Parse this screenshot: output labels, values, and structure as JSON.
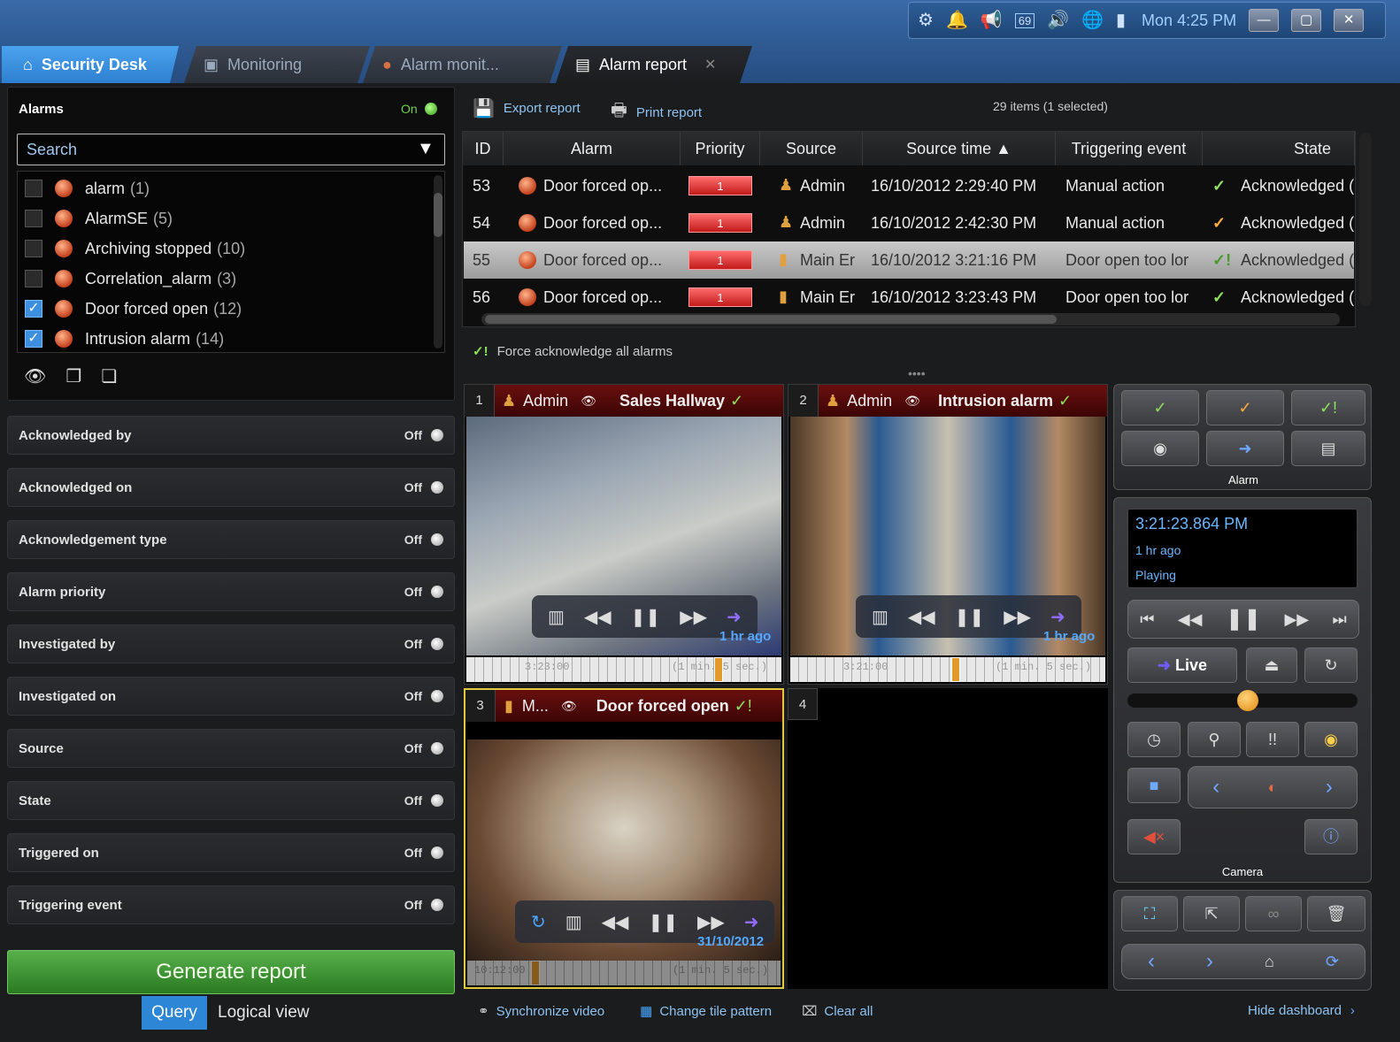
{
  "systray": {
    "clock": "Mon 4:25 PM",
    "badge": "69"
  },
  "tabs": [
    {
      "label": "Security Desk",
      "icon": "home-icon"
    },
    {
      "label": "Monitoring",
      "icon": "monitor-icon"
    },
    {
      "label": "Alarm monit...",
      "icon": "alarm-icon"
    },
    {
      "label": "Alarm report",
      "icon": "report-icon",
      "close": "✕"
    }
  ],
  "left": {
    "title": "Alarms",
    "on_label": "On",
    "search_placeholder": "Search",
    "alarms": [
      {
        "name": "alarm",
        "count": "(1)",
        "checked": false
      },
      {
        "name": "AlarmSE",
        "count": "(5)",
        "checked": false
      },
      {
        "name": "Archiving stopped",
        "count": "(10)",
        "checked": false
      },
      {
        "name": "Correlation_alarm",
        "count": "(3)",
        "checked": false
      },
      {
        "name": "Door forced open",
        "count": "(12)",
        "checked": true
      },
      {
        "name": "Intrusion alarm",
        "count": "(14)",
        "checked": true
      }
    ],
    "filters": [
      {
        "label": "Acknowledged by",
        "state": "Off"
      },
      {
        "label": "Acknowledged on",
        "state": "Off"
      },
      {
        "label": "Acknowledgement type",
        "state": "Off"
      },
      {
        "label": "Alarm priority",
        "state": "Off"
      },
      {
        "label": "Investigated by",
        "state": "Off"
      },
      {
        "label": "Investigated on",
        "state": "Off"
      },
      {
        "label": "Source",
        "state": "Off"
      },
      {
        "label": "State",
        "state": "Off"
      },
      {
        "label": "Triggered on",
        "state": "Off"
      },
      {
        "label": "Triggering event",
        "state": "Off"
      }
    ],
    "generate": "Generate report",
    "query_tab": "Query",
    "logical_tab": "Logical view"
  },
  "toolbar": {
    "export": "Export report",
    "print": "Print report",
    "items": "29 items (1 selected)"
  },
  "table": {
    "headers": [
      "ID",
      "Alarm",
      "Priority",
      "Source",
      "Source time ▲",
      "Triggering event",
      "State"
    ],
    "rows": [
      {
        "id": "53",
        "alarm": "Door forced op...",
        "priority": "1",
        "source": "Admin",
        "time": "16/10/2012 2:29:40 PM",
        "event": "Manual action",
        "state": "Acknowledged (",
        "selected": false
      },
      {
        "id": "54",
        "alarm": "Door forced op...",
        "priority": "1",
        "source": "Admin",
        "time": "16/10/2012 2:42:30 PM",
        "event": "Manual action",
        "state": "Acknowledged (",
        "selected": false
      },
      {
        "id": "55",
        "alarm": "Door forced op...",
        "priority": "1",
        "source": "Main Er",
        "time": "16/10/2012 3:21:16 PM",
        "event": "Door open too lor",
        "state": "Acknowledged (",
        "selected": true
      },
      {
        "id": "56",
        "alarm": "Door forced op...",
        "priority": "1",
        "source": "Main Er",
        "time": "16/10/2012 3:23:43 PM",
        "event": "Door open too lor",
        "state": "Acknowledged (",
        "selected": false
      }
    ]
  },
  "force_ack": "Force acknowledge all alarms",
  "tiles": [
    {
      "num": "1",
      "user": "Admin",
      "title": "Sales Hallway",
      "ago": "1 hr ago",
      "tl_left": "3:23:00",
      "tl_right": "(1 min. 5 sec.)"
    },
    {
      "num": "2",
      "user": "Admin",
      "title": "Intrusion alarm",
      "ago": "1 hr ago",
      "tl_left": "3:21:00",
      "tl_right": "(1 min. 5 sec.)"
    },
    {
      "num": "3",
      "user": "M...",
      "title": "Door forced open",
      "ago": "31/10/2012",
      "tl_left": "10:12:00",
      "tl_right": "(1 min. 5 sec.)"
    },
    {
      "num": "4"
    }
  ],
  "dashboard": {
    "alarm_label": "Alarm",
    "time": "3:21:23.864 PM",
    "ago": "1 hr ago",
    "status": "Playing",
    "live": "Live",
    "camera_label": "Camera"
  },
  "bottom": {
    "sync": "Synchronize video",
    "change": "Change tile pattern",
    "clear": "Clear all",
    "hide": "Hide dashboard"
  }
}
